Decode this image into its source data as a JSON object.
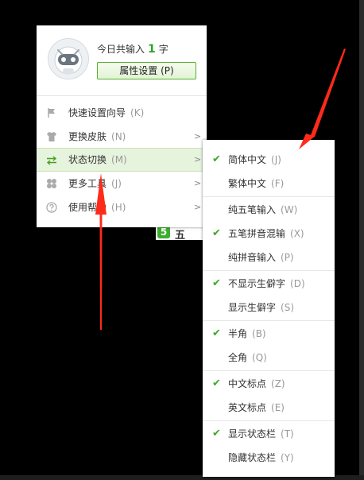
{
  "profile": {
    "count_prefix": "今日共输入",
    "count_value": "1",
    "count_suffix": "字",
    "props_button": "属性设置 (P)"
  },
  "main_menu": {
    "items": [
      {
        "label": "快速设置向导",
        "key": "(K)",
        "icon": "flag-icon",
        "has_submenu": false
      },
      {
        "label": "更换皮肤",
        "key": "(N)",
        "icon": "tshirt-icon",
        "has_submenu": true
      },
      {
        "label": "状态切换",
        "key": "(M)",
        "icon": "swap-arrows-icon",
        "has_submenu": true,
        "active": true
      },
      {
        "label": "更多工具",
        "key": "(J)",
        "icon": "tools-icon",
        "has_submenu": true
      },
      {
        "label": "使用帮助",
        "key": "(H)",
        "icon": "help-icon",
        "has_submenu": true
      }
    ]
  },
  "background_window": {
    "logo": "5",
    "text": "五"
  },
  "submenu": {
    "items": [
      {
        "label": "简体中文",
        "key": "(J)",
        "checked": true
      },
      {
        "label": "繁体中文",
        "key": "(F)",
        "checked": false
      },
      {
        "label": "纯五笔输入",
        "key": "(W)",
        "checked": false
      },
      {
        "label": "五笔拼音混输",
        "key": "(X)",
        "checked": true
      },
      {
        "label": "纯拼音输入",
        "key": "(P)",
        "checked": false
      },
      {
        "label": "不显示生僻字",
        "key": "(D)",
        "checked": true
      },
      {
        "label": "显示生僻字",
        "key": "(S)",
        "checked": false
      },
      {
        "label": "半角",
        "key": "(B)",
        "checked": true
      },
      {
        "label": "全角",
        "key": "(Q)",
        "checked": false
      },
      {
        "label": "中文标点",
        "key": "(Z)",
        "checked": true
      },
      {
        "label": "英文标点",
        "key": "(E)",
        "checked": false
      },
      {
        "label": "显示状态栏",
        "key": "(T)",
        "checked": true
      },
      {
        "label": "隐藏状态栏",
        "key": "(Y)",
        "checked": false
      }
    ],
    "check_glyph": "✔"
  },
  "arrow_glyph": ">",
  "colors": {
    "accent": "#46a11e",
    "annotation": "#ff2a1a"
  }
}
